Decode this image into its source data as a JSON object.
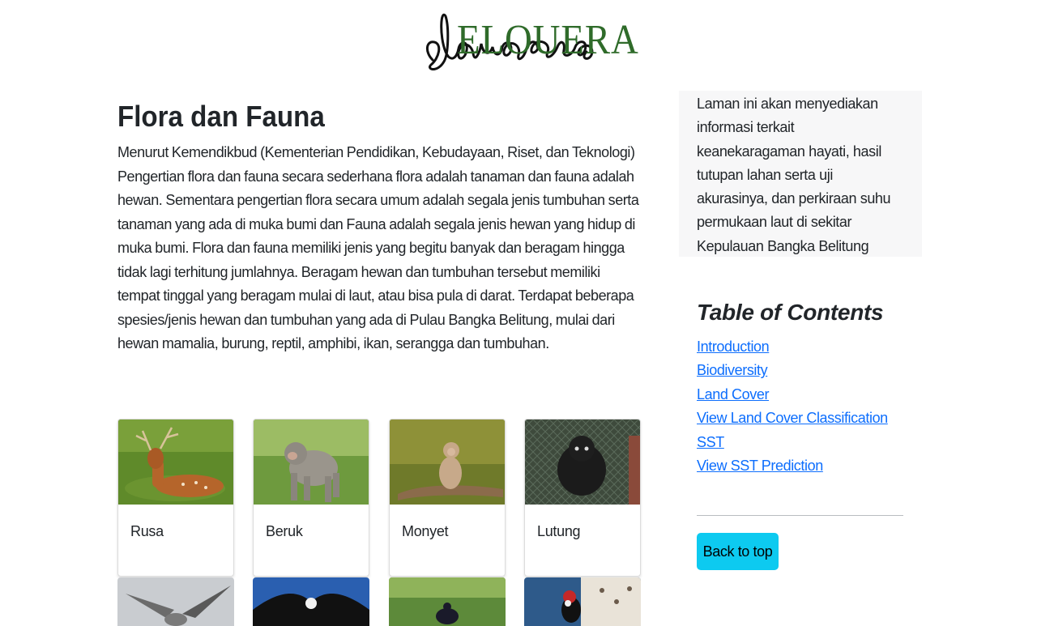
{
  "brand": {
    "logo_text": "ELOUERA",
    "logo_color": "#2f6b2a"
  },
  "main": {
    "title": "Flora dan Fauna",
    "intro": "Menurut Kemendikbud (Kementerian Pendidikan, Kebudayaan, Riset, dan Teknologi) Pengertian flora dan fauna secara sederhana flora adalah tanaman dan fauna adalah hewan. Sementara pengertian flora secara umum adalah segala jenis tumbuhan serta tanaman yang ada di muka bumi dan Fauna adalah segala jenis hewan yang hidup di muka bumi. Flora dan fauna memiliki jenis yang begitu banyak dan beragam hingga tidak lagi terhitung jumlahnya. Beragam hewan dan tumbuhan tersebut memiliki tempat tinggal yang beragam mulai di laut, atau bisa pula di darat. Terdapat beberapa spesies/jenis hewan dan tumbuhan yang ada di Pulau Bangka Belitung, mulai dari hewan mamalia, burung, reptil, amphibi, ikan, serangga dan tumbuhan."
  },
  "sidebar": {
    "about": "Laman ini akan menyediakan informasi terkait keanekaragaman hayati, hasil tutupan lahan serta uji akurasinya, dan perkiraan suhu permukaan laut di sekitar Kepulauan Bangka Belitung",
    "toc_title": "Table of Contents",
    "toc_links": [
      "Introduction",
      "Biodiversity",
      "Land Cover",
      "View Land Cover Classification",
      "SST",
      "View SST Prediction"
    ],
    "back_to_top": "Back to top"
  },
  "cards": [
    {
      "title": "Rusa",
      "icon": "deer-photo"
    },
    {
      "title": "Beruk",
      "icon": "macaque-photo"
    },
    {
      "title": "Monyet",
      "icon": "monkey-photo"
    },
    {
      "title": "Lutung",
      "icon": "langur-photo"
    }
  ],
  "cards_row2": [
    {
      "icon": "bird-photo"
    },
    {
      "icon": "eagle-photo"
    },
    {
      "icon": "black-bird-photo"
    },
    {
      "icon": "woodpecker-photo"
    }
  ],
  "colors": {
    "link": "#0d6efd",
    "button": "#0dcaf0",
    "sidebar_bg": "#f7f7f8"
  }
}
